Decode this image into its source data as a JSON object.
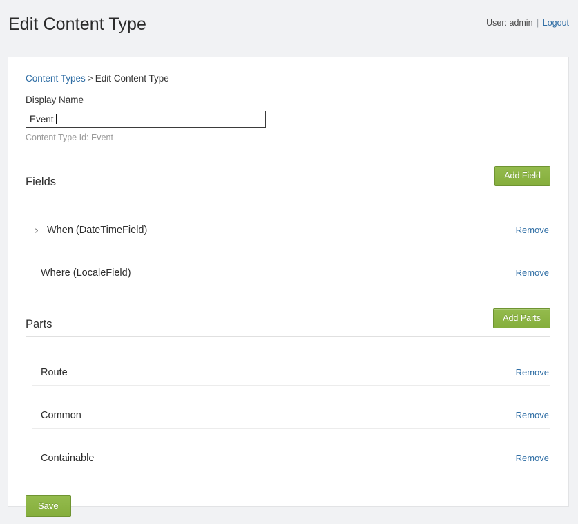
{
  "header": {
    "title": "Edit Content Type",
    "user_prefix": "User: admin",
    "separator": "|",
    "logout_label": "Logout"
  },
  "breadcrumb": {
    "parent_label": "Content Types",
    "separator": ">",
    "current_label": "Edit Content Type"
  },
  "form": {
    "display_name_label": "Display Name",
    "display_name_value": "Event",
    "display_name_placeholder": "",
    "content_type_id_hint": "Content Type Id: Event"
  },
  "fields_section": {
    "title": "Fields",
    "add_button_label": "Add Field",
    "items": [
      {
        "label": "When (DateTimeField)",
        "remove_label": "Remove",
        "toggle_icon": "chevron-right-icon",
        "toggle_glyph": "›",
        "expandable": true
      },
      {
        "label": "Where (LocaleField)",
        "remove_label": "Remove",
        "toggle_icon": "",
        "toggle_glyph": "",
        "expandable": false
      }
    ]
  },
  "parts_section": {
    "title": "Parts",
    "add_button_label": "Add Parts",
    "items": [
      {
        "label": "Route",
        "remove_label": "Remove",
        "toggle_icon": "",
        "toggle_glyph": "",
        "expandable": false
      },
      {
        "label": "Common",
        "remove_label": "Remove",
        "toggle_icon": "",
        "toggle_glyph": "",
        "expandable": false
      },
      {
        "label": "Containable",
        "remove_label": "Remove",
        "toggle_icon": "",
        "toggle_glyph": "",
        "expandable": false
      }
    ]
  },
  "footer": {
    "save_label": "Save"
  },
  "colors": {
    "page_background": "#f1f2f4",
    "panel_background": "#ffffff",
    "panel_border": "#e2e3e5",
    "link": "#2e6da4",
    "button_green": "#8cb544",
    "button_green_border": "#6f9432",
    "hint_text": "#9b9b9b",
    "divider": "#ececec"
  }
}
